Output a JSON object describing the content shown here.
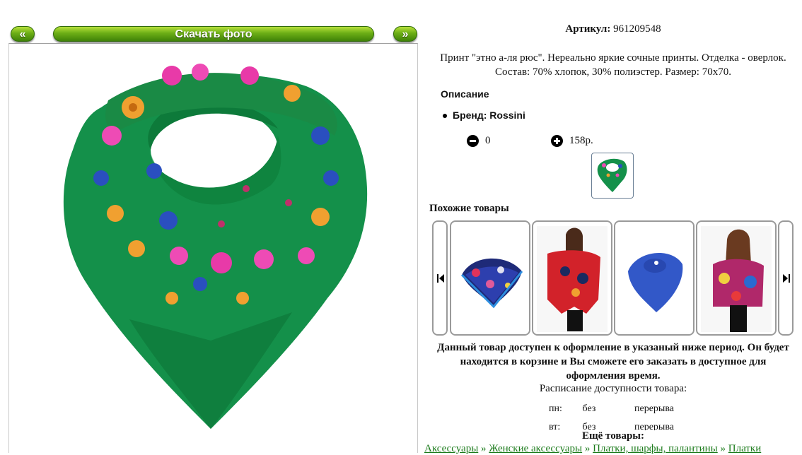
{
  "toolbar": {
    "prev_label": "«",
    "download_label": "Скачать фото",
    "next_label": "»"
  },
  "product": {
    "article_label": "Артикул:",
    "article_value": "961209548",
    "description_line1": "Принт \"этно а-ля рюс\". Нереально яркие сочные принты. Отделка - оверлок.",
    "description_line2": "Состав: 70% хлопок, 30% полиэстер. Размер: 70х70.",
    "section_title": "Описание",
    "brand": "Бренд: Rossini",
    "quantity": "0",
    "price": "158р."
  },
  "similar": {
    "title": "Похожие товары"
  },
  "availability": {
    "notice_line1": "Данный товар доступен к оформление в указаный ниже период. Он будет",
    "notice_line2": "находится в корзине и Вы сможете его заказать в доступное для",
    "notice_line3": "оформления время.",
    "schedule_title": "Расписание доступности товара:",
    "rows": [
      {
        "day": "пн:",
        "from": "без",
        "to": "перерыва"
      },
      {
        "day": "вт:",
        "from": "без",
        "to": "перерыва"
      }
    ]
  },
  "more": {
    "title": "Ещё товары:",
    "breadcrumbs": [
      "Аксессуары",
      "Женские аксессуары",
      "Платки, шарфы, палантины",
      "Платки"
    ]
  },
  "colors": {
    "button_green": "#6cae16",
    "scarf_green": "#14904a",
    "link_green": "#1a7a1a"
  }
}
